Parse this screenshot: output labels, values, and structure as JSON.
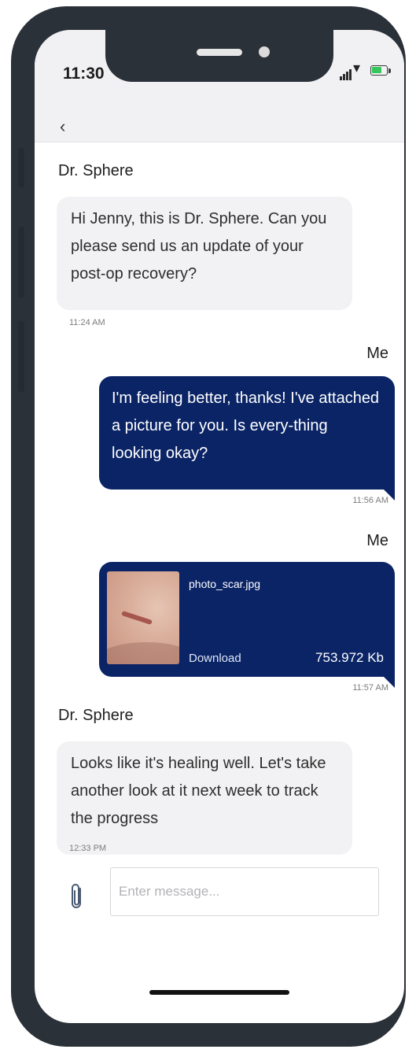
{
  "status_bar": {
    "time": "11:30",
    "battery_color": "#35c759",
    "battery_level": 0.7,
    "icons": [
      "cellular-signal-icon",
      "wifi-icon",
      "battery-icon"
    ]
  },
  "header": {
    "back_icon": "chevron-left-icon",
    "back_glyph": "‹"
  },
  "colors": {
    "outgoing_bubble": "#0a2466",
    "incoming_bubble": "#f2f2f4"
  },
  "messages": [
    {
      "sender": "Dr. Sphere",
      "direction": "incoming",
      "text": "Hi Jenny, this is Dr. Sphere. Can you please send us an update of your post-op recovery?",
      "time": "11:24 AM"
    },
    {
      "sender": "Me",
      "direction": "outgoing",
      "text": "I'm feeling better, thanks! I've attached a picture for you. Is every-thing looking okay?",
      "time": "11:56 AM"
    },
    {
      "sender": "Me",
      "direction": "outgoing",
      "attachment": {
        "filename": "photo_scar.jpg",
        "download_label": "Download",
        "size": "753.972 Kb"
      },
      "time": "11:57 AM"
    },
    {
      "sender": "Dr. Sphere",
      "direction": "incoming",
      "text": "Looks like it's healing well. Let's take another look at it next week to track the progress",
      "time": "12:33 PM"
    }
  ],
  "composer": {
    "attach_icon": "paperclip-icon",
    "placeholder": "Enter message...",
    "value": ""
  }
}
